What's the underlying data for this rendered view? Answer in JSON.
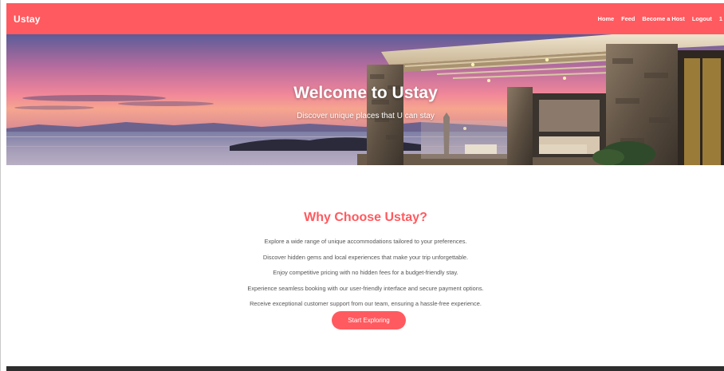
{
  "navbar": {
    "brand": "Ustay",
    "links": [
      "Home",
      "Feed",
      "Become a Host",
      "Logout",
      "1"
    ],
    "color": "#ff5a5f"
  },
  "hero": {
    "title": "Welcome to Ustay",
    "subtitle": "Discover unique places that U can stay"
  },
  "why": {
    "title": "Why Choose Ustay?",
    "items": [
      "Explore a wide range of unique accommodations tailored to your preferences.",
      "Discover hidden gems and local experiences that make your trip unforgettable.",
      "Enjoy competitive pricing with no hidden fees for a budget-friendly stay.",
      "Experience seamless booking with our user-friendly interface and secure payment options.",
      "Receive exceptional customer support from our team, ensuring a hassle-free experience."
    ],
    "cta_label": "Start Exploring"
  },
  "colors": {
    "accent": "#ff5a5f",
    "text_muted": "#555555",
    "footer": "#2d2d2d"
  }
}
